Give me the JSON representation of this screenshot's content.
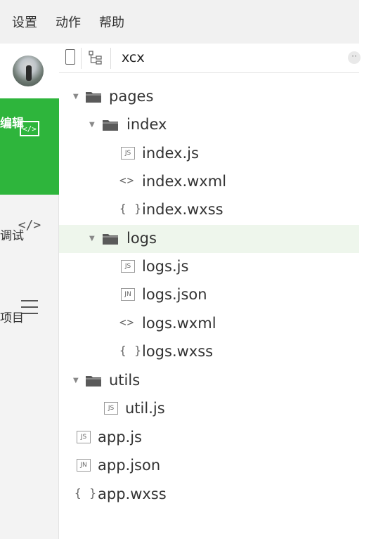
{
  "menubar": {
    "items": [
      "设置",
      "动作",
      "帮助"
    ]
  },
  "sidebar": {
    "avatar_alt": "",
    "items": [
      {
        "label": "编辑",
        "icon": "code-box-icon",
        "active": true
      },
      {
        "label": "调试",
        "icon": "code-brackets-icon",
        "icon_text": "</>"
      },
      {
        "label": "项目",
        "icon": "hamburger-icon"
      }
    ]
  },
  "tabbar": {
    "title": "xcx",
    "more": "··"
  },
  "tree": {
    "rows": [
      {
        "label": "pages",
        "type": "folder",
        "expanded": true
      },
      {
        "label": "index",
        "type": "folder",
        "expanded": true
      },
      {
        "label": "index.js",
        "type": "file",
        "badge": "JS"
      },
      {
        "label": "index.wxml",
        "type": "file",
        "glyph": "<>"
      },
      {
        "label": "index.wxss",
        "type": "file",
        "glyph": "{ }"
      },
      {
        "label": "logs",
        "type": "folder",
        "expanded": true,
        "selected": true
      },
      {
        "label": "logs.js",
        "type": "file",
        "badge": "JS"
      },
      {
        "label": "logs.json",
        "type": "file",
        "badge": "JN"
      },
      {
        "label": "logs.wxml",
        "type": "file",
        "glyph": "<>"
      },
      {
        "label": "logs.wxss",
        "type": "file",
        "glyph": "{ }"
      },
      {
        "label": "utils",
        "type": "folder",
        "expanded": true
      },
      {
        "label": "util.js",
        "type": "file",
        "badge": "JS"
      },
      {
        "label": "app.js",
        "type": "file",
        "badge": "JS"
      },
      {
        "label": "app.json",
        "type": "file",
        "badge": "JN"
      },
      {
        "label": "app.wxss",
        "type": "file",
        "glyph": "{ }"
      }
    ]
  }
}
